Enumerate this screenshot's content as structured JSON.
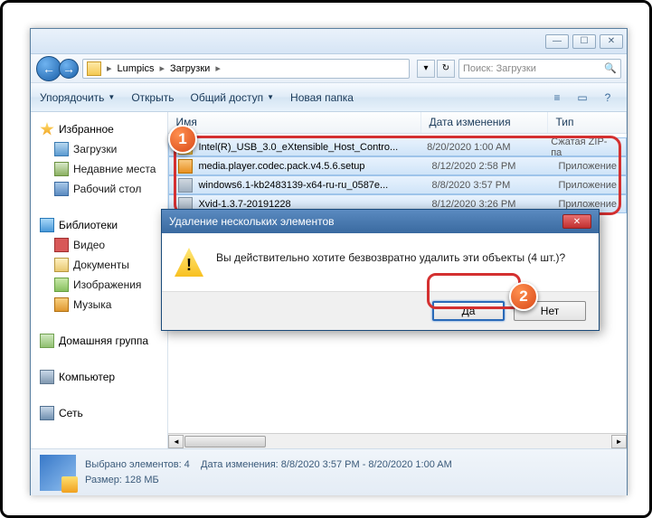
{
  "title_buttons": {
    "min": "—",
    "max": "☐",
    "close": "✕"
  },
  "breadcrumb": {
    "seg1": "Lumpics",
    "seg2": "Загрузки",
    "arrow": "▸"
  },
  "addr_buttons": {
    "down": "▾",
    "refresh": "↻"
  },
  "search": {
    "placeholder": "Поиск: Загрузки",
    "icon": "🔍"
  },
  "toolbar": {
    "organize": "Упорядочить",
    "open": "Открыть",
    "share": "Общий доступ",
    "newfolder": "Новая папка",
    "drop": "▼"
  },
  "sidebar": {
    "favorites": "Избранное",
    "downloads": "Загрузки",
    "recent": "Недавние места",
    "desktop": "Рабочий стол",
    "libraries": "Библиотеки",
    "video": "Видео",
    "documents": "Документы",
    "images": "Изображения",
    "music": "Музыка",
    "homegroup": "Домашняя группа",
    "computer": "Компьютер",
    "network": "Сеть"
  },
  "columns": {
    "name": "Имя",
    "date": "Дата изменения",
    "type": "Тип"
  },
  "files": [
    {
      "name": "Intel(R)_USB_3.0_eXtensible_Host_Contro...",
      "date": "8/20/2020 1:00 AM",
      "type": "Сжатая ZIP-па"
    },
    {
      "name": "media.player.codec.pack.v4.5.6.setup",
      "date": "8/12/2020 2:58 PM",
      "type": "Приложение"
    },
    {
      "name": "windows6.1-kb2483139-x64-ru-ru_0587e...",
      "date": "8/8/2020 3:57 PM",
      "type": "Приложение"
    },
    {
      "name": "Xvid-1.3.7-20191228",
      "date": "8/12/2020 3:26 PM",
      "type": "Приложение"
    }
  ],
  "status": {
    "line1_label": "Выбрано элементов: 4",
    "line1_date": "Дата изменения: 8/8/2020 3:57 PM - 8/20/2020 1:00 AM",
    "line2": "Размер: 128 МБ"
  },
  "dialog": {
    "title": "Удаление нескольких элементов",
    "close": "✕",
    "message": "Вы действительно хотите безвозвратно удалить эти объекты (4 шт.)?",
    "yes": "Да",
    "no": "Нет",
    "warn": "!"
  },
  "callouts": {
    "c1": "1",
    "c2": "2"
  },
  "scroll": {
    "left": "◄",
    "right": "►"
  }
}
